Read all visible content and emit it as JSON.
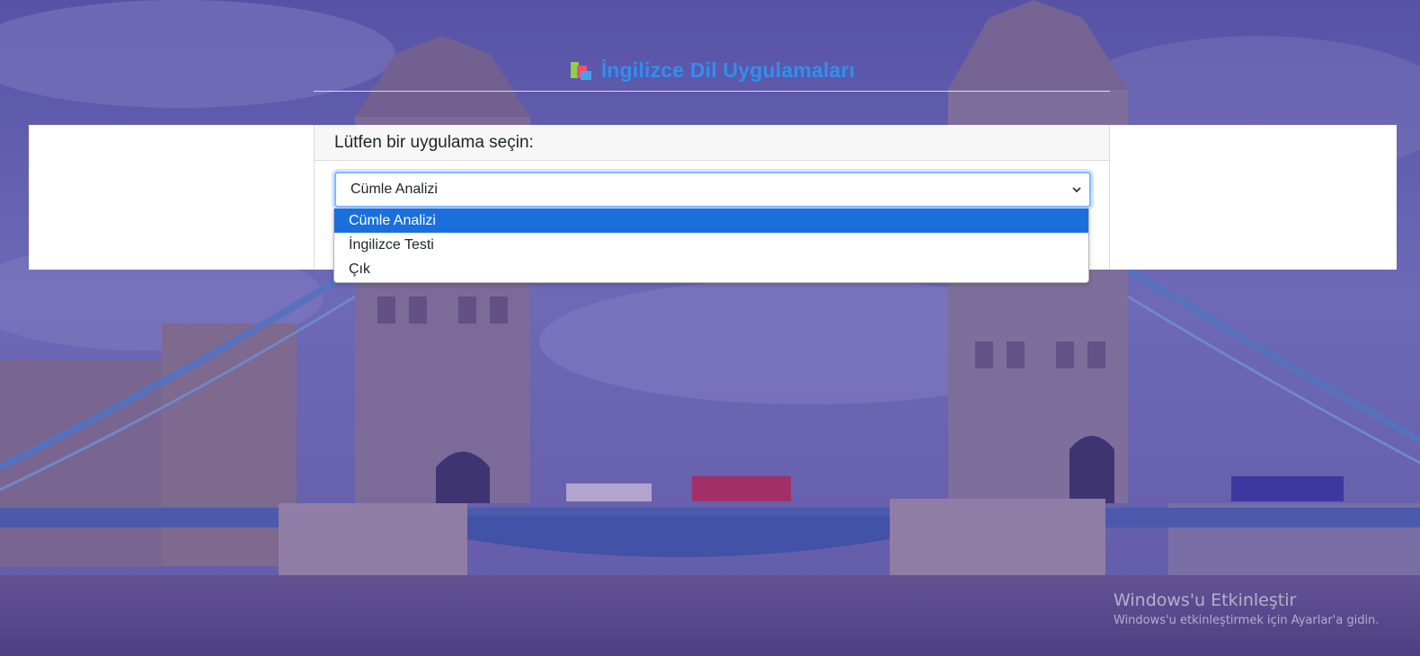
{
  "header": {
    "title": "İngilizce Dil Uygulamaları",
    "icon": "books-icon"
  },
  "card": {
    "prompt": "Lütfen bir uygulama seçin:",
    "select": {
      "value": "Cümle Analizi",
      "options": [
        "Cümle Analizi",
        "İngilizce Testi",
        "Çık"
      ],
      "highlighted": "Cümle Analizi"
    }
  },
  "watermark": {
    "title": "Windows'u Etkinleştir",
    "subtitle": "Windows'u etkinleştirmek için Ayarlar'a gidin."
  },
  "colors": {
    "title": "#2f8ff0",
    "highlight": "#1a6fdc",
    "focus_border": "#86b7fe"
  }
}
